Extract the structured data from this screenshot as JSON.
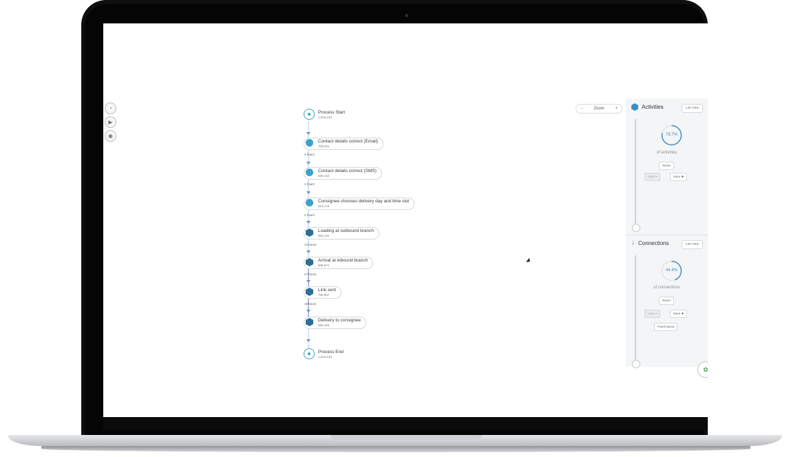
{
  "flow": {
    "nodes": [
      {
        "name": "Process Start",
        "count": "1,015,130",
        "kind": "start"
      },
      {
        "name": "Contact details correct (Email)",
        "count": "709,221",
        "kind": "activity"
      },
      {
        "name": "Contact details correct (SMS)",
        "count": "569,152",
        "kind": "activity"
      },
      {
        "name": "Consignee chooses delivery day and time slot",
        "count": "513,710",
        "kind": "activity"
      },
      {
        "name": "Loading at outbound branch",
        "count": "964,131",
        "kind": "hex"
      },
      {
        "name": "Arrival at inbound branch",
        "count": "906,571",
        "kind": "hex"
      },
      {
        "name": "Link sent",
        "count": "780,967",
        "kind": "hex"
      },
      {
        "name": "Delivery to consignee",
        "count": "882,153",
        "kind": "hex"
      },
      {
        "name": "Process End",
        "count": "1,015,130",
        "kind": "end"
      }
    ],
    "durations": [
      "3 hours",
      "1 hours",
      "4 hours",
      "12 hours",
      "27 hours",
      "19 hours"
    ]
  },
  "zoom": {
    "minus": "−",
    "label": "Zoom",
    "plus": "+"
  },
  "activities": {
    "title": "Activities",
    "list_view": "List view",
    "percent": "78.7%",
    "percent_value": 0.787,
    "subtitle": "of activities",
    "reset": "Reset",
    "less": "Less ━",
    "more": "More ✚"
  },
  "connections": {
    "title": "Connections",
    "list_view": "List view",
    "percent": "44.4%",
    "percent_value": 0.444,
    "subtitle": "of connections",
    "reset": "Reset",
    "less": "Less ━",
    "more": "More ✚",
    "fixed_layout": "Fixed layout"
  },
  "colors": {
    "accent": "#3a8fc7",
    "activity": "#3aa3c9",
    "hex": "#2d6f96"
  },
  "icons": {
    "start": "play-icon",
    "end": "stop-icon",
    "tool1": "pie-icon",
    "tool2": "play-icon",
    "tool3": "eye-icon"
  }
}
